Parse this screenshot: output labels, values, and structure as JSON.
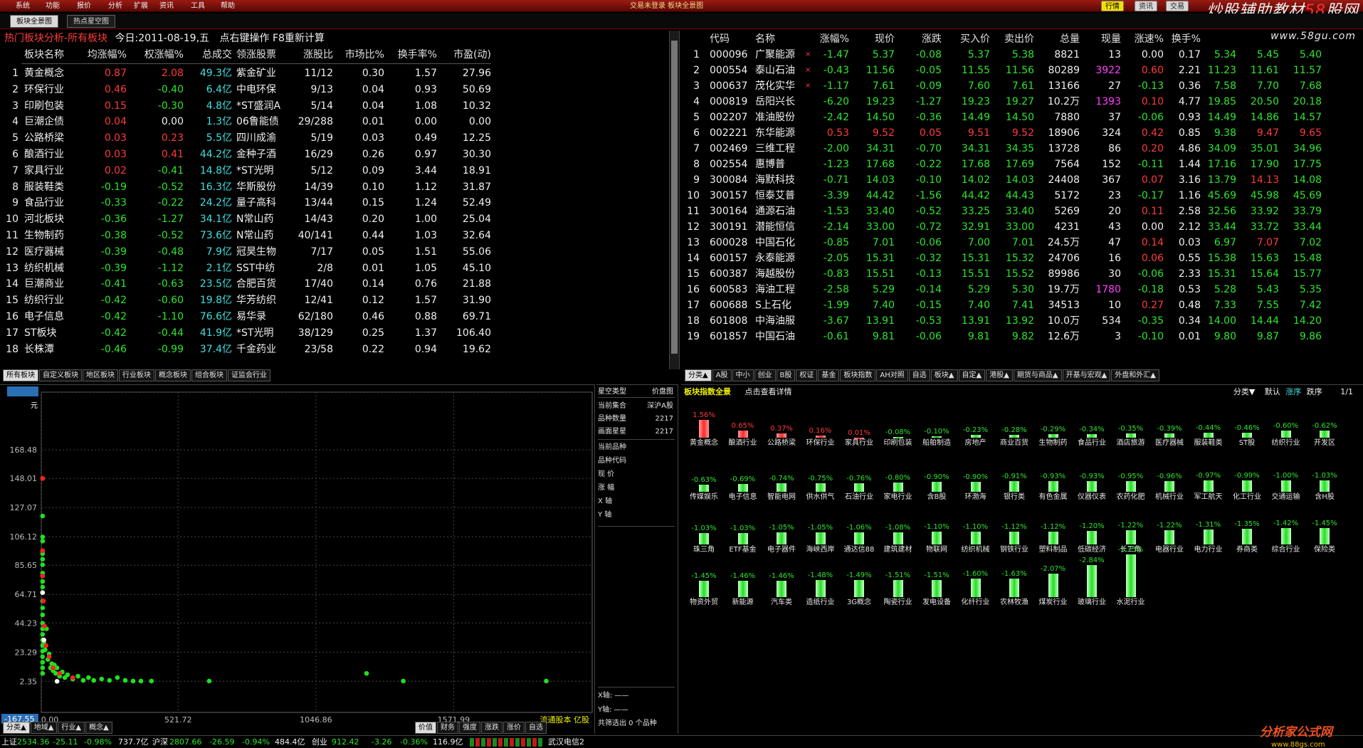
{
  "menu": {
    "items": [
      "系统",
      "功能",
      "报价",
      "分析",
      "扩展",
      "资讯",
      "工具",
      "帮助"
    ],
    "title": "交易未登录 板块全景图",
    "pills": [
      "行情",
      "资讯",
      "交易"
    ],
    "brand_a": "炒股辅助教材",
    "brand_b": "58",
    "brand_c": "股网",
    "site": "www.58gu.com"
  },
  "tabs": [
    "板块全景图",
    "热点星空图"
  ],
  "left_top": {
    "title": "热门板块分析-所有板块",
    "date_label": "今日:2011-08-19,五",
    "hint": "点右键操作 F8重新计算",
    "headers": [
      "板块名称",
      "均涨幅%",
      "权涨幅%",
      "总成交",
      "领涨股票",
      "涨股比",
      "市场比%",
      "换手率%",
      "市盈(动)"
    ],
    "rows": [
      [
        "1",
        "黄金概念",
        "0.87",
        "2.08",
        "49.3亿",
        "紫金矿业",
        "11/12",
        "0.30",
        "1.57",
        "27.96"
      ],
      [
        "2",
        "环保行业",
        "0.46",
        "-0.40",
        "6.4亿",
        "中电环保",
        "9/13",
        "0.04",
        "0.93",
        "50.69"
      ],
      [
        "3",
        "印刷包装",
        "0.15",
        "-0.30",
        "4.8亿",
        "*ST盛润A",
        "5/14",
        "0.04",
        "1.08",
        "10.32"
      ],
      [
        "4",
        "巨潮企债",
        "0.04",
        "0.00",
        "1.3亿",
        "06鲁能债",
        "29/288",
        "0.01",
        "0.00",
        "0.00"
      ],
      [
        "5",
        "公路桥梁",
        "0.03",
        "0.23",
        "5.5亿",
        "四川成渝",
        "5/19",
        "0.03",
        "0.49",
        "12.25"
      ],
      [
        "6",
        "酿酒行业",
        "0.03",
        "0.41",
        "44.2亿",
        "金种子酒",
        "16/29",
        "0.26",
        "0.97",
        "30.30"
      ],
      [
        "7",
        "家具行业",
        "0.02",
        "-0.41",
        "14.8亿",
        "*ST光明",
        "5/12",
        "0.09",
        "3.44",
        "18.91"
      ],
      [
        "8",
        "服装鞋类",
        "-0.19",
        "-0.52",
        "16.3亿",
        "华斯股份",
        "14/39",
        "0.10",
        "1.12",
        "31.87"
      ],
      [
        "9",
        "食品行业",
        "-0.33",
        "-0.22",
        "24.2亿",
        "量子高科",
        "13/44",
        "0.15",
        "1.24",
        "52.49"
      ],
      [
        "10",
        "河北板块",
        "-0.36",
        "-1.27",
        "34.1亿",
        "N常山药",
        "14/43",
        "0.20",
        "1.00",
        "25.04"
      ],
      [
        "11",
        "生物制药",
        "-0.38",
        "-0.52",
        "73.6亿",
        "N常山药",
        "40/141",
        "0.44",
        "1.03",
        "32.64"
      ],
      [
        "12",
        "医疗器械",
        "-0.39",
        "-0.48",
        "7.9亿",
        "冠昊生物",
        "7/17",
        "0.05",
        "1.51",
        "55.06"
      ],
      [
        "13",
        "纺织机械",
        "-0.39",
        "-1.12",
        "2.1亿",
        "SST中纺",
        "2/8",
        "0.01",
        "1.05",
        "45.10"
      ],
      [
        "14",
        "巨潮商业",
        "-0.41",
        "-0.63",
        "23.5亿",
        "合肥百货",
        "17/40",
        "0.14",
        "0.76",
        "21.88"
      ],
      [
        "15",
        "纺织行业",
        "-0.42",
        "-0.60",
        "19.8亿",
        "华芳纺织",
        "12/41",
        "0.12",
        "1.57",
        "31.90"
      ],
      [
        "16",
        "电子信息",
        "-0.42",
        "-1.10",
        "76.6亿",
        "易华录",
        "62/180",
        "0.46",
        "0.88",
        "69.71"
      ],
      [
        "17",
        "ST板块",
        "-0.42",
        "-0.44",
        "41.9亿",
        "*ST光明",
        "38/129",
        "0.25",
        "1.37",
        "106.40"
      ],
      [
        "18",
        "长株潭",
        "-0.46",
        "-0.99",
        "37.4亿",
        "千金药业",
        "23/58",
        "0.22",
        "0.94",
        "19.62"
      ]
    ],
    "sheet_tabs": [
      "所有板块",
      "自定义板块",
      "地区板块",
      "行业板块",
      "概念板块",
      "组合板块",
      "证监会行业"
    ]
  },
  "right_top": {
    "headers": [
      "代码",
      "名称",
      "涨幅%",
      "现价",
      "涨跌",
      "买入价",
      "卖出价",
      "总量",
      "现量",
      "涨速%",
      "换手%",
      "",
      "",
      ""
    ],
    "rows": [
      [
        "1",
        "000096",
        "广聚能源",
        "-1.47",
        "5.37",
        "-0.08",
        "5.37",
        "5.38",
        "8821",
        "13",
        "0.00",
        "0.17",
        "5.34",
        "5.45",
        "5.40"
      ],
      [
        "2",
        "000554",
        "泰山石油",
        "-0.43",
        "11.56",
        "-0.05",
        "11.55",
        "11.56",
        "80289",
        "3922",
        "0.60",
        "2.21",
        "11.23",
        "11.61",
        "11.57"
      ],
      [
        "3",
        "000637",
        "茂化实华",
        "-1.17",
        "7.61",
        "-0.09",
        "7.60",
        "7.61",
        "13166",
        "27",
        "-0.13",
        "0.36",
        "7.58",
        "7.70",
        "7.68"
      ],
      [
        "4",
        "000819",
        "岳阳兴长",
        "-6.20",
        "19.23",
        "-1.27",
        "19.23",
        "19.27",
        "10.2万",
        "1393",
        "0.10",
        "4.77",
        "19.85",
        "20.50",
        "20.18"
      ],
      [
        "5",
        "002207",
        "准油股份",
        "-2.42",
        "14.50",
        "-0.36",
        "14.49",
        "14.50",
        "7880",
        "37",
        "-0.06",
        "0.93",
        "14.49",
        "14.86",
        "14.57"
      ],
      [
        "6",
        "002221",
        "东华能源",
        "0.53",
        "9.52",
        "0.05",
        "9.51",
        "9.52",
        "18906",
        "324",
        "0.42",
        "0.85",
        "9.38",
        "9.47",
        "9.65"
      ],
      [
        "7",
        "002469",
        "三维工程",
        "-2.00",
        "34.31",
        "-0.70",
        "34.31",
        "34.35",
        "13728",
        "86",
        "0.20",
        "4.86",
        "34.09",
        "35.01",
        "34.96"
      ],
      [
        "8",
        "002554",
        "惠博普",
        "-1.23",
        "17.68",
        "-0.22",
        "17.68",
        "17.69",
        "7564",
        "152",
        "-0.11",
        "1.44",
        "17.16",
        "17.90",
        "17.75"
      ],
      [
        "9",
        "300084",
        "海默科技",
        "-0.71",
        "14.03",
        "-0.10",
        "14.02",
        "14.03",
        "24408",
        "367",
        "0.07",
        "3.16",
        "13.79",
        "14.13",
        "14.08"
      ],
      [
        "10",
        "300157",
        "恒泰艾普",
        "-3.39",
        "44.42",
        "-1.56",
        "44.42",
        "44.43",
        "5172",
        "23",
        "-0.17",
        "1.16",
        "45.69",
        "45.98",
        "45.69"
      ],
      [
        "11",
        "300164",
        "通源石油",
        "-1.53",
        "33.40",
        "-0.52",
        "33.25",
        "33.40",
        "5269",
        "20",
        "0.11",
        "2.58",
        "32.56",
        "33.92",
        "33.79"
      ],
      [
        "12",
        "300191",
        "潜能恒信",
        "-2.14",
        "33.00",
        "-0.72",
        "32.91",
        "33.00",
        "4231",
        "43",
        "0.00",
        "2.12",
        "33.44",
        "33.72",
        "33.44"
      ],
      [
        "13",
        "600028",
        "中国石化",
        "-0.85",
        "7.01",
        "-0.06",
        "7.00",
        "7.01",
        "24.5万",
        "47",
        "0.14",
        "0.03",
        "6.97",
        "7.07",
        "7.02"
      ],
      [
        "14",
        "600157",
        "永泰能源",
        "-2.05",
        "15.31",
        "-0.32",
        "15.31",
        "15.32",
        "24706",
        "16",
        "0.06",
        "0.55",
        "15.38",
        "15.63",
        "15.48"
      ],
      [
        "15",
        "600387",
        "海越股份",
        "-0.83",
        "15.51",
        "-0.13",
        "15.51",
        "15.52",
        "89986",
        "30",
        "-0.06",
        "2.33",
        "15.31",
        "15.64",
        "15.77"
      ],
      [
        "16",
        "600583",
        "海油工程",
        "-2.58",
        "5.29",
        "-0.14",
        "5.29",
        "5.30",
        "19.7万",
        "1780",
        "-0.18",
        "0.53",
        "5.28",
        "5.43",
        "5.35"
      ],
      [
        "17",
        "600688",
        "S上石化",
        "-1.99",
        "7.40",
        "-0.15",
        "7.40",
        "7.41",
        "34513",
        "10",
        "0.27",
        "0.48",
        "7.33",
        "7.55",
        "7.42"
      ],
      [
        "18",
        "601808",
        "中海油服",
        "-3.67",
        "13.91",
        "-0.53",
        "13.91",
        "13.92",
        "10.0万",
        "534",
        "-0.35",
        "0.34",
        "14.00",
        "14.44",
        "14.20"
      ],
      [
        "19",
        "601857",
        "中国石油",
        "-0.61",
        "9.81",
        "-0.06",
        "9.81",
        "9.82",
        "12.6万",
        "3",
        "-0.10",
        "0.01",
        "9.80",
        "9.87",
        "9.86"
      ]
    ],
    "sheet_tabs": [
      "分类▲",
      "A股",
      "中小",
      "创业",
      "B股",
      "权证",
      "基金",
      "板块指数",
      "AH对照",
      "自选",
      "板块▲",
      "自定▲",
      "港股▲",
      "期货与商品▲",
      "开基与宏观▲",
      "外盘和外汇▲"
    ]
  },
  "scatter": {
    "y_ticks": [
      "209.90",
      "168.48",
      "148.01",
      "127.07",
      "106.12",
      "85.65",
      "64.71",
      "44.23",
      "23.29",
      "2.35",
      "-167.55"
    ],
    "y_unit": "元",
    "x_ticks": [
      "0.00",
      "521.72",
      "1046.86",
      "1571.99"
    ],
    "x_label": "流通股本 亿股",
    "points": [
      [
        5,
        148
      ],
      [
        5,
        121
      ],
      [
        5,
        106
      ],
      [
        5,
        103
      ],
      [
        5,
        96
      ],
      [
        5,
        94
      ],
      [
        5,
        90
      ],
      [
        5,
        86
      ],
      [
        5,
        80
      ],
      [
        5,
        78
      ],
      [
        5,
        74
      ],
      [
        5,
        70
      ],
      [
        5,
        66
      ],
      [
        5,
        60
      ],
      [
        5,
        55
      ],
      [
        5,
        50
      ],
      [
        5,
        44
      ],
      [
        5,
        40
      ],
      [
        5,
        36
      ],
      [
        5,
        32
      ],
      [
        5,
        28
      ],
      [
        5,
        24
      ],
      [
        5,
        20
      ],
      [
        5,
        16
      ],
      [
        5,
        12
      ],
      [
        5,
        8
      ],
      [
        10,
        30
      ],
      [
        15,
        25
      ],
      [
        20,
        40
      ],
      [
        25,
        18
      ],
      [
        30,
        22
      ],
      [
        35,
        12
      ],
      [
        40,
        15
      ],
      [
        45,
        10
      ],
      [
        50,
        14
      ],
      [
        55,
        8
      ],
      [
        60,
        12
      ],
      [
        70,
        6
      ],
      [
        80,
        9
      ],
      [
        90,
        5
      ],
      [
        100,
        7
      ],
      [
        120,
        4
      ],
      [
        140,
        6
      ],
      [
        160,
        3
      ],
      [
        180,
        5
      ],
      [
        200,
        3
      ],
      [
        230,
        4
      ],
      [
        260,
        3
      ],
      [
        290,
        5
      ],
      [
        320,
        3
      ],
      [
        350,
        2.5
      ],
      [
        380,
        2.5
      ],
      [
        420,
        2.5
      ],
      [
        640,
        2.5
      ],
      [
        1240,
        8
      ],
      [
        1380,
        2.5
      ],
      [
        1925,
        2.5
      ]
    ],
    "red_points": [
      [
        5,
        148
      ],
      [
        5,
        96
      ],
      [
        5,
        78
      ],
      [
        8,
        60
      ],
      [
        12,
        42
      ],
      [
        18,
        28
      ],
      [
        30,
        20
      ],
      [
        45,
        12
      ],
      [
        70,
        8
      ],
      [
        120,
        5
      ]
    ],
    "white_points": [
      [
        5,
        66
      ],
      [
        10,
        32
      ],
      [
        60,
        2.35
      ]
    ],
    "sheet_tabs": [
      "分类▲",
      "地域▲",
      "行业▲",
      "概念▲"
    ],
    "right_tabs": [
      "价值",
      "财务",
      "强度",
      "涨跌",
      "涨价",
      "自选"
    ]
  },
  "scatter_info": {
    "title": "星空类型",
    "type_value": "价盘图",
    "rows": [
      [
        "当前集合",
        "深沪A股"
      ],
      [
        "品种数量",
        "2217"
      ],
      [
        "画面星星",
        "2217"
      ]
    ],
    "fields": [
      "当前品种",
      "品种代码",
      "现 价",
      "涨 幅",
      "X 轴",
      "Y 轴"
    ],
    "x_axis": "X轴: ——",
    "y_axis": "Y轴: ——",
    "filter": "共筛选出 0 个品种"
  },
  "index_panel": {
    "title": "板块指数全景",
    "hint": "点击查看详情",
    "sort": [
      "分类▼",
      "默认",
      "涨序",
      "跌序"
    ],
    "page": "1/1",
    "items": [
      [
        "黄金概念",
        "1.56%",
        "1.56"
      ],
      [
        "酿酒行业",
        "0.65%",
        "0.65"
      ],
      [
        "公路桥梁",
        "0.37%",
        "0.37"
      ],
      [
        "环保行业",
        "0.16%",
        "0.16"
      ],
      [
        "家具行业",
        "0.01%",
        "0.01"
      ],
      [
        "印刷包装",
        "-0.08%",
        "-0.08"
      ],
      [
        "船舶制造",
        "-0.10%",
        "-0.10"
      ],
      [
        "房地产",
        "-0.23%",
        "-0.23"
      ],
      [
        "商业百货",
        "-0.28%",
        "-0.28"
      ],
      [
        "生物制药",
        "-0.29%",
        "-0.29"
      ],
      [
        "食品行业",
        "-0.34%",
        "-0.34"
      ],
      [
        "酒店旅游",
        "-0.35%",
        "-0.35"
      ],
      [
        "医疗器械",
        "-0.39%",
        "-0.39"
      ],
      [
        "服装鞋类",
        "-0.44%",
        "-0.44"
      ],
      [
        "ST股",
        "-0.46%",
        "-0.46"
      ],
      [
        "纺织行业",
        "-0.60%",
        "-0.60"
      ],
      [
        "开发区",
        "-0.62%",
        "-0.62"
      ],
      [
        "传媒娱乐",
        "-0.63%",
        "-0.63"
      ],
      [
        "电子信息",
        "-0.69%",
        "-0.69"
      ],
      [
        "智能电网",
        "-0.74%",
        "-0.74"
      ],
      [
        "供水供气",
        "-0.75%",
        "-0.75"
      ],
      [
        "石油行业",
        "-0.76%",
        "-0.76"
      ],
      [
        "家电行业",
        "-0.80%",
        "-0.80"
      ],
      [
        "含B股",
        "-0.90%",
        "-0.90"
      ],
      [
        "环渤海",
        "-0.90%",
        "-0.90"
      ],
      [
        "银行类",
        "-0.91%",
        "-0.91"
      ],
      [
        "有色金属",
        "-0.93%",
        "-0.93"
      ],
      [
        "仪器仪表",
        "-0.93%",
        "-0.93"
      ],
      [
        "农药化肥",
        "-0.95%",
        "-0.95"
      ],
      [
        "机械行业",
        "-0.96%",
        "-0.96"
      ],
      [
        "军工航天",
        "-0.97%",
        "-0.97"
      ],
      [
        "化工行业",
        "-0.99%",
        "-0.99"
      ],
      [
        "交通运输",
        "-1.00%",
        "-1.00"
      ],
      [
        "含H股",
        "-1.03%",
        "-1.03"
      ],
      [
        "珠三角",
        "-1.03%",
        "-1.03"
      ],
      [
        "ETF基金",
        "-1.03%",
        "-1.03"
      ],
      [
        "电子器件",
        "-1.05%",
        "-1.05"
      ],
      [
        "海峡西岸",
        "-1.05%",
        "-1.05"
      ],
      [
        "通达信88",
        "-1.06%",
        "-1.06"
      ],
      [
        "建筑建材",
        "-1.08%",
        "-1.08"
      ],
      [
        "物联网",
        "-1.10%",
        "-1.10"
      ],
      [
        "纺织机械",
        "-1.10%",
        "-1.10"
      ],
      [
        "钢铁行业",
        "-1.12%",
        "-1.12"
      ],
      [
        "塑料制品",
        "-1.12%",
        "-1.12"
      ],
      [
        "低碳经济",
        "-1.20%",
        "-1.20"
      ],
      [
        "长三角",
        "-1.22%",
        "-1.22"
      ],
      [
        "电器行业",
        "-1.22%",
        "-1.22"
      ],
      [
        "电力行业",
        "-1.31%",
        "-1.31"
      ],
      [
        "券商类",
        "-1.35%",
        "-1.35"
      ],
      [
        "综合行业",
        "-1.42%",
        "-1.42"
      ],
      [
        "保险类",
        "-1.45%",
        "-1.45"
      ],
      [
        "物资外贸",
        "-1.45%",
        "-1.45"
      ],
      [
        "新能源",
        "-1.46%",
        "-1.46"
      ],
      [
        "汽车类",
        "-1.46%",
        "-1.46"
      ],
      [
        "造纸行业",
        "-1.48%",
        "-1.48"
      ],
      [
        "3G概念",
        "-1.49%",
        "-1.49"
      ],
      [
        "陶瓷行业",
        "-1.51%",
        "-1.51"
      ],
      [
        "发电设备",
        "-1.51%",
        "-1.51"
      ],
      [
        "化纤行业",
        "-1.60%",
        "-1.60"
      ],
      [
        "农林牧渔",
        "-1.63%",
        "-1.63"
      ],
      [
        "煤炭行业",
        "-2.07%",
        "-2.07"
      ],
      [
        "玻璃行业",
        "-2.84%",
        "-2.84"
      ],
      [
        "水泥行业",
        "-3.75%",
        "-3.75"
      ]
    ]
  },
  "status": {
    "sh_label": "上证",
    "sh_val": "2534.36",
    "sh_chg": "-25.11",
    "sh_pct": "-0.98%",
    "sh_amt": "737.7亿",
    "sz_label": "沪深",
    "sz_val": "2807.66",
    "sz_chg": "-26.59",
    "sz_pct": "-0.94%",
    "sz_amt": "484.4亿",
    "cy_label": "创业",
    "cy_val": "912.42",
    "cy_chg": "-3.26",
    "cy_pct": "-0.36%",
    "cy_amt": "116.9亿",
    "broker": "武汉电信2"
  },
  "footer_brand": {
    "name": "分析家公式网",
    "url": "www.88gs.com"
  }
}
